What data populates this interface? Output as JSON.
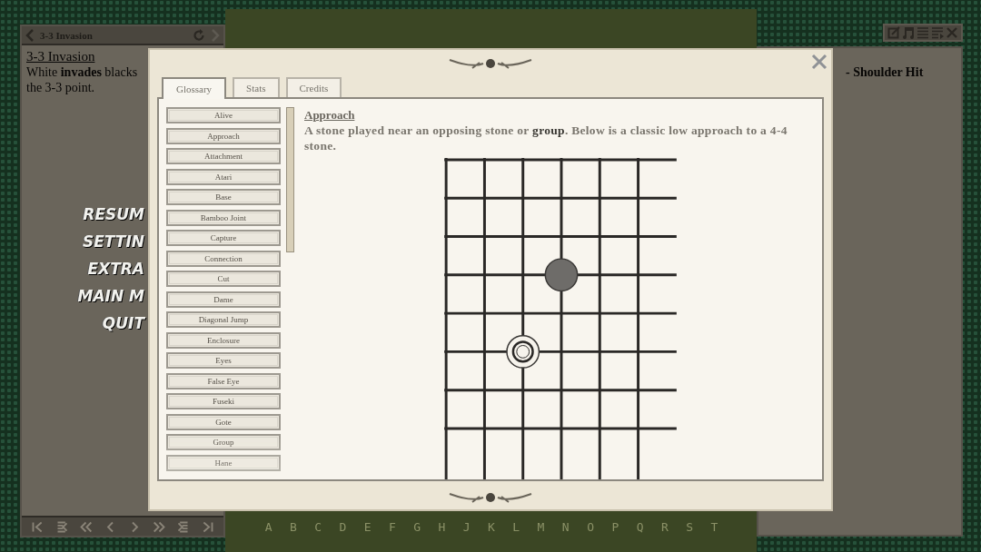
{
  "left_panel": {
    "header": {
      "title": "3-3 Invasion"
    },
    "heading": "3-3 Invasion",
    "lines": [
      "White **invades** blacks",
      "the 3-3 point."
    ],
    "menu": [
      "RESUM",
      "SETTIN",
      "EXTRA",
      "MAIN M",
      "QUIT"
    ]
  },
  "right_panel": {
    "lines": [
      "- Shoulder Hit"
    ]
  },
  "board": {
    "column_labels": [
      "A",
      "B",
      "C",
      "D",
      "E",
      "F",
      "G",
      "H",
      "J",
      "K",
      "L",
      "M",
      "N",
      "O",
      "P",
      "Q",
      "R",
      "S",
      "T"
    ]
  },
  "dialog": {
    "tabs": [
      {
        "label": "Glossary",
        "selected": true
      },
      {
        "label": "Stats",
        "selected": false
      },
      {
        "label": "Credits",
        "selected": false
      }
    ],
    "glossary": [
      "Alive",
      "Approach",
      "Attachment",
      "Atari",
      "Base",
      "Bamboo Joint",
      "Capture",
      "Connection",
      "Cut",
      "Dame",
      "Diagonal Jump",
      "Enclosure",
      "Eyes",
      "False Eye",
      "Fuseki",
      "Gote",
      "Group",
      "Hane"
    ],
    "entry": {
      "title": "Approach",
      "text": "A stone played near an opposing stone or **group**.  Below is a classic low approach to a 4-4 stone.",
      "diagram": [
        [
          {
            "kind": "empty"
          },
          {
            "kind": "empty"
          },
          {
            "kind": "empty"
          },
          {
            "kind": "empty"
          },
          {
            "kind": "empty"
          },
          {
            "kind": "empty"
          },
          {
            "kind": "empty"
          }
        ],
        [
          {
            "kind": "empty"
          },
          {
            "kind": "empty"
          },
          {
            "kind": "empty"
          },
          {
            "kind": "empty"
          },
          {
            "kind": "empty"
          },
          {
            "kind": "empty"
          },
          {
            "kind": "empty"
          }
        ],
        [
          {
            "kind": "empty"
          },
          {
            "kind": "empty"
          },
          {
            "kind": "empty"
          },
          {
            "kind": "empty"
          },
          {
            "kind": "empty"
          },
          {
            "kind": "empty"
          },
          {
            "kind": "empty"
          }
        ],
        [
          {
            "kind": "empty"
          },
          {
            "kind": "empty"
          },
          {
            "kind": "empty"
          },
          {
            "kind": "black"
          },
          {
            "kind": "empty"
          },
          {
            "kind": "empty"
          },
          {
            "kind": "empty"
          }
        ],
        [
          {
            "kind": "empty"
          },
          {
            "kind": "empty"
          },
          {
            "kind": "empty"
          },
          {
            "kind": "empty"
          },
          {
            "kind": "empty"
          },
          {
            "kind": "empty"
          },
          {
            "kind": "empty"
          }
        ],
        [
          {
            "kind": "empty"
          },
          {
            "kind": "empty"
          },
          {
            "kind": "white"
          },
          {
            "kind": "empty"
          },
          {
            "kind": "empty"
          },
          {
            "kind": "empty"
          },
          {
            "kind": "empty"
          }
        ],
        [
          {
            "kind": "empty"
          },
          {
            "kind": "empty"
          },
          {
            "kind": "empty"
          },
          {
            "kind": "empty"
          },
          {
            "kind": "empty"
          },
          {
            "kind": "empty"
          },
          {
            "kind": "empty"
          }
        ],
        [
          {
            "kind": "empty"
          },
          {
            "kind": "empty"
          },
          {
            "kind": "empty"
          },
          {
            "kind": "empty"
          },
          {
            "kind": "empty"
          },
          {
            "kind": "empty"
          },
          {
            "kind": "empty"
          }
        ],
        [
          {
            "kind": "empty"
          },
          {
            "kind": "empty"
          },
          {
            "kind": "empty"
          },
          {
            "kind": "empty"
          },
          {
            "kind": "empty"
          },
          {
            "kind": "empty"
          },
          {
            "kind": "empty"
          }
        ]
      ]
    }
  }
}
